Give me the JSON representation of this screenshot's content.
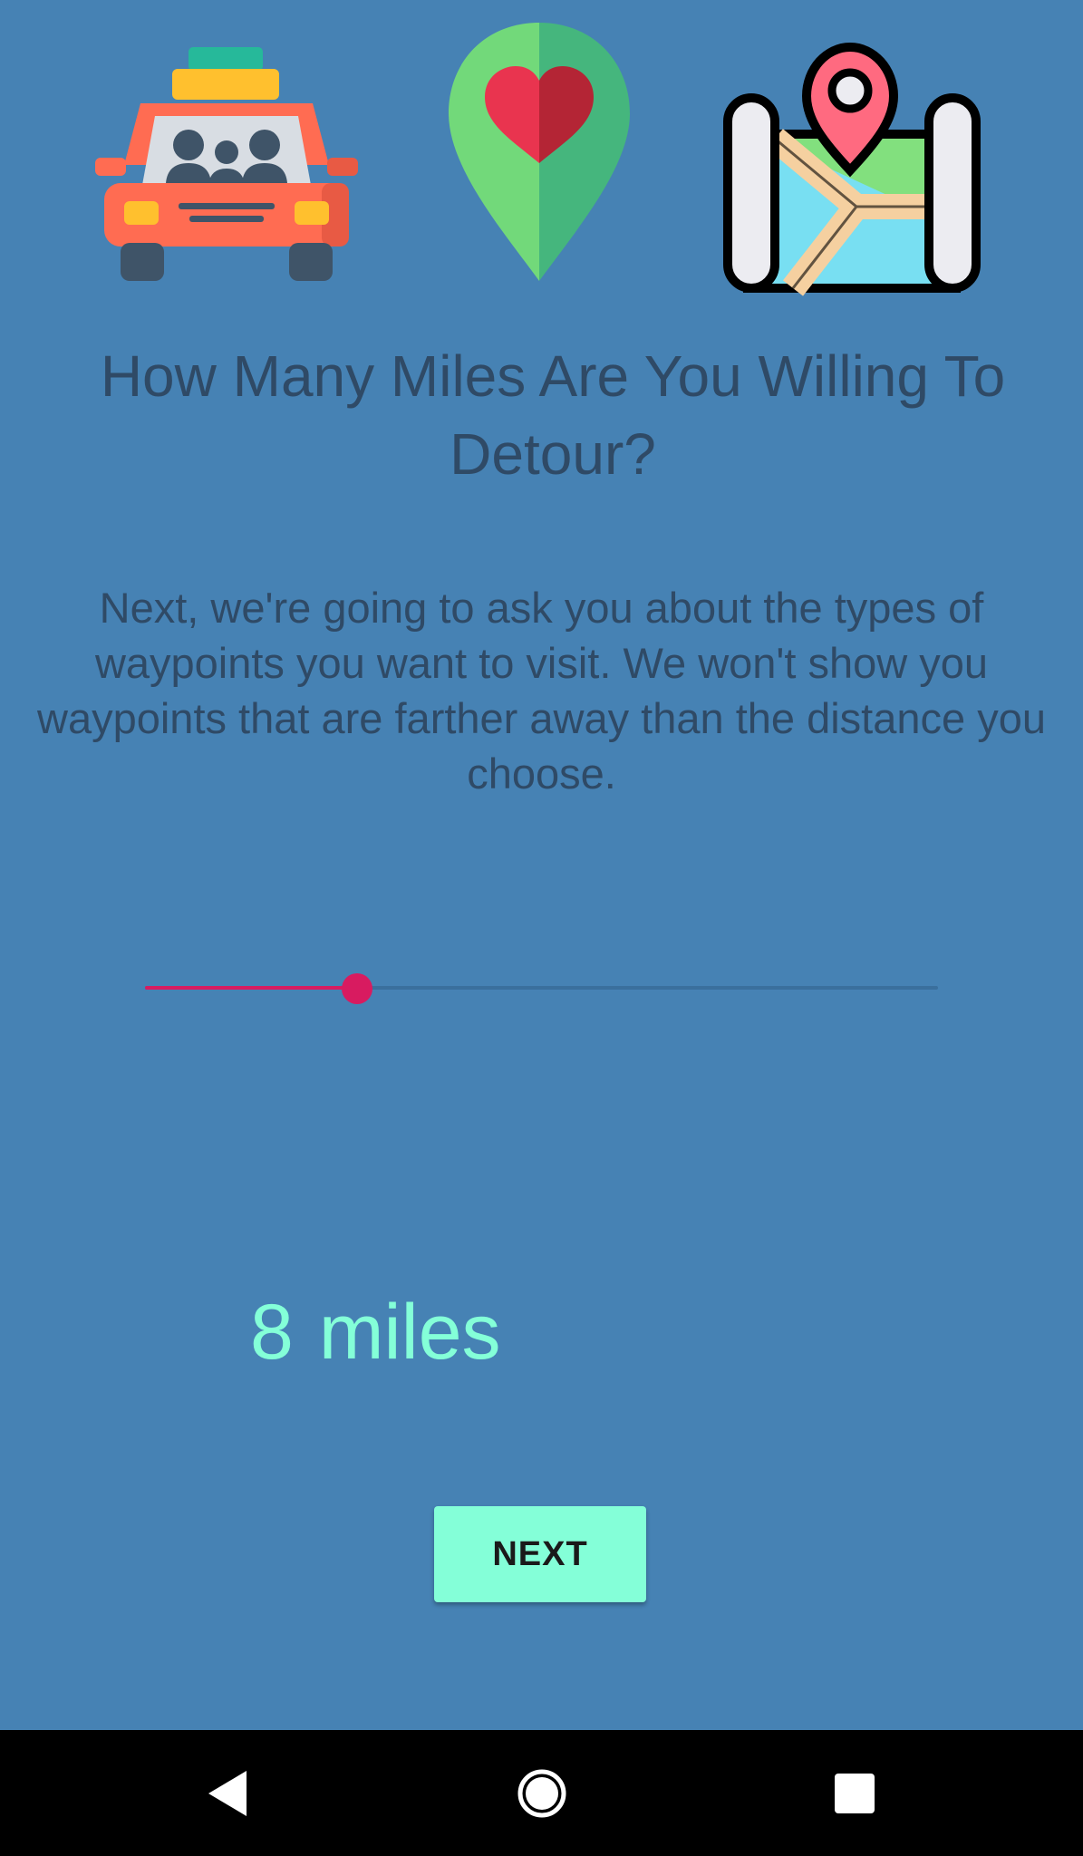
{
  "screen": {
    "title": "How Many Miles Are You Willing To Detour?",
    "description": "Next, we're going to ask you about the types of waypoints you want to visit. We won't show you waypoints that are farther away than the distance you choose."
  },
  "icons": [
    "car-icon",
    "location-heart-pin-icon",
    "map-pin-icon"
  ],
  "slider": {
    "value_fraction": 0.267,
    "accent_color": "#d81b60"
  },
  "distance": {
    "value": "8",
    "unit": "miles"
  },
  "next_button": {
    "label": "NEXT"
  },
  "colors": {
    "background": "#4682b4",
    "text": "#2f4a66",
    "accent": "#84ffd8"
  },
  "navbar": {
    "buttons": [
      "back-icon",
      "home-icon",
      "recents-icon"
    ]
  }
}
